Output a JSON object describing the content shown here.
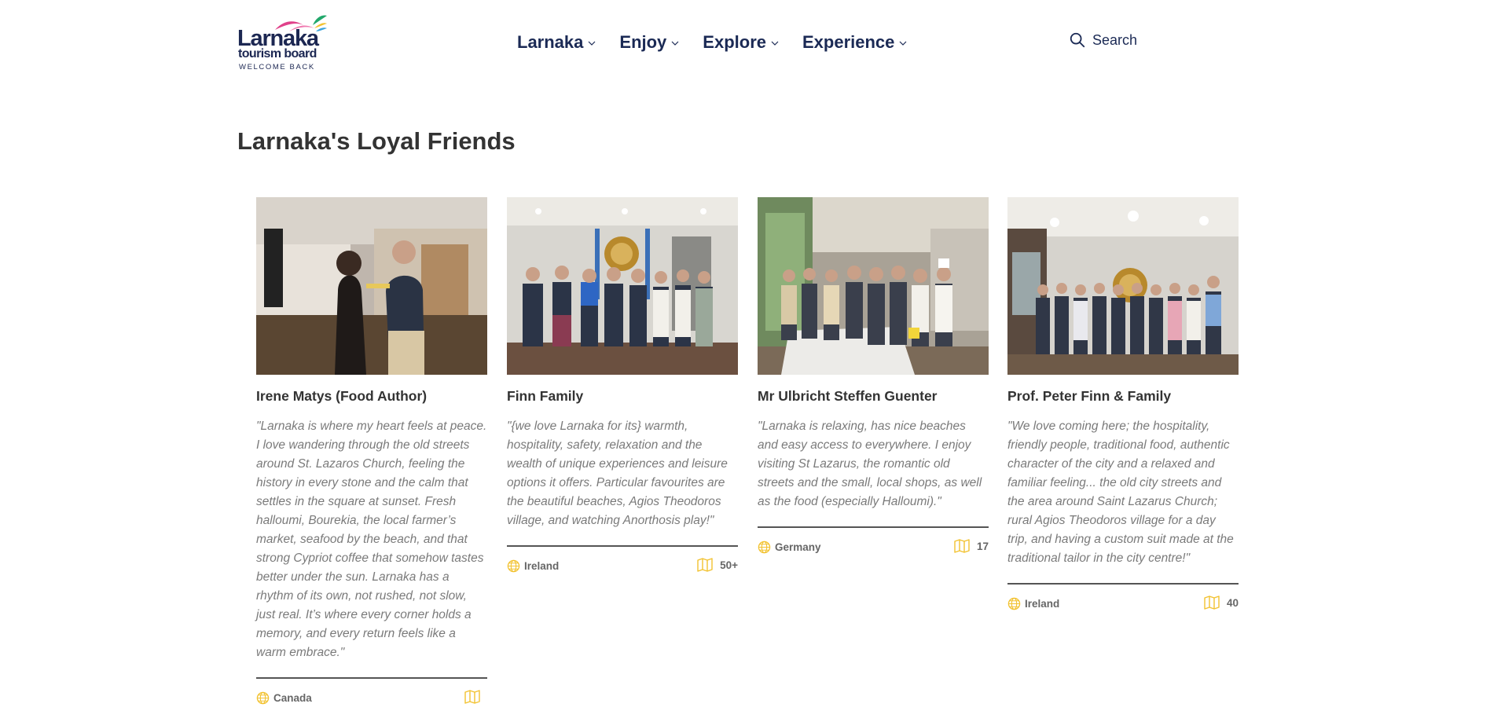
{
  "logo": {
    "word": "Larnaka",
    "sub": "tourism board",
    "welcome": "WELCOME BACK"
  },
  "nav": {
    "items": [
      {
        "label": "Larnaka"
      },
      {
        "label": "Enjoy"
      },
      {
        "label": "Explore"
      },
      {
        "label": "Experience"
      }
    ]
  },
  "search": {
    "label": "Search"
  },
  "section": {
    "title": "Larnaka's Loyal Friends"
  },
  "cards": [
    {
      "name": "Irene Matys (Food Author)",
      "quote": "\"Larnaka is where my heart feels at peace. I love wandering through the old streets around St. Lazaros Church, feeling the history in every stone and the calm that settles in the square at sunset. Fresh halloumi, Bourekia, the local farmer’s market, seafood by the beach, and that strong Cypriot coffee that somehow tastes better under the sun. Larnaka has a rhythm of its own, not rushed, not slow, just real. It’s where every corner holds a memory, and every return feels like a warm embrace.\"",
      "country": "Canada",
      "visits": ""
    },
    {
      "name": "Finn Family",
      "quote": "\"{we love Larnaka for its} warmth, hospitality, safety, relaxation and the wealth of unique experiences and leisure options it offers. Particular favourites are the beautiful beaches, Agios Theodoros village, and watching Anorthosis play!\"",
      "country": "Ireland",
      "visits": "50+"
    },
    {
      "name": "Mr Ulbricht Steffen Guenter",
      "quote": "\"Larnaka is relaxing, has nice beaches and easy access to everywhere. I enjoy visiting St Lazarus, the romantic old streets and the small, local shops, as well as the food (especially Halloumi).\"",
      "country": "Germany",
      "visits": "17"
    },
    {
      "name": "Prof. Peter Finn & Family",
      "quote": "\"We love coming here; the hospitality, friendly people, traditional food, authentic character of the city and a relaxed and familiar feeling... the old city streets and the area around Saint Lazarus Church; rural Agios Theodoros village for a day trip, and having a custom suit made at the traditional tailor in the city centre!\"",
      "country": "Ireland",
      "visits": "40"
    }
  ],
  "icons": {
    "country": "globe-icon",
    "visits": "map-icon",
    "search": "search-icon",
    "dropdown": "chevron-down-icon"
  },
  "colors": {
    "brand_navy": "#1b2a55",
    "accent_yellow": "#f2c230",
    "logo_pink": "#e0418a",
    "logo_green": "#22a86b",
    "logo_blue": "#3aa3dc",
    "text_dark": "#333333",
    "text_quote": "#7a7a7a"
  }
}
